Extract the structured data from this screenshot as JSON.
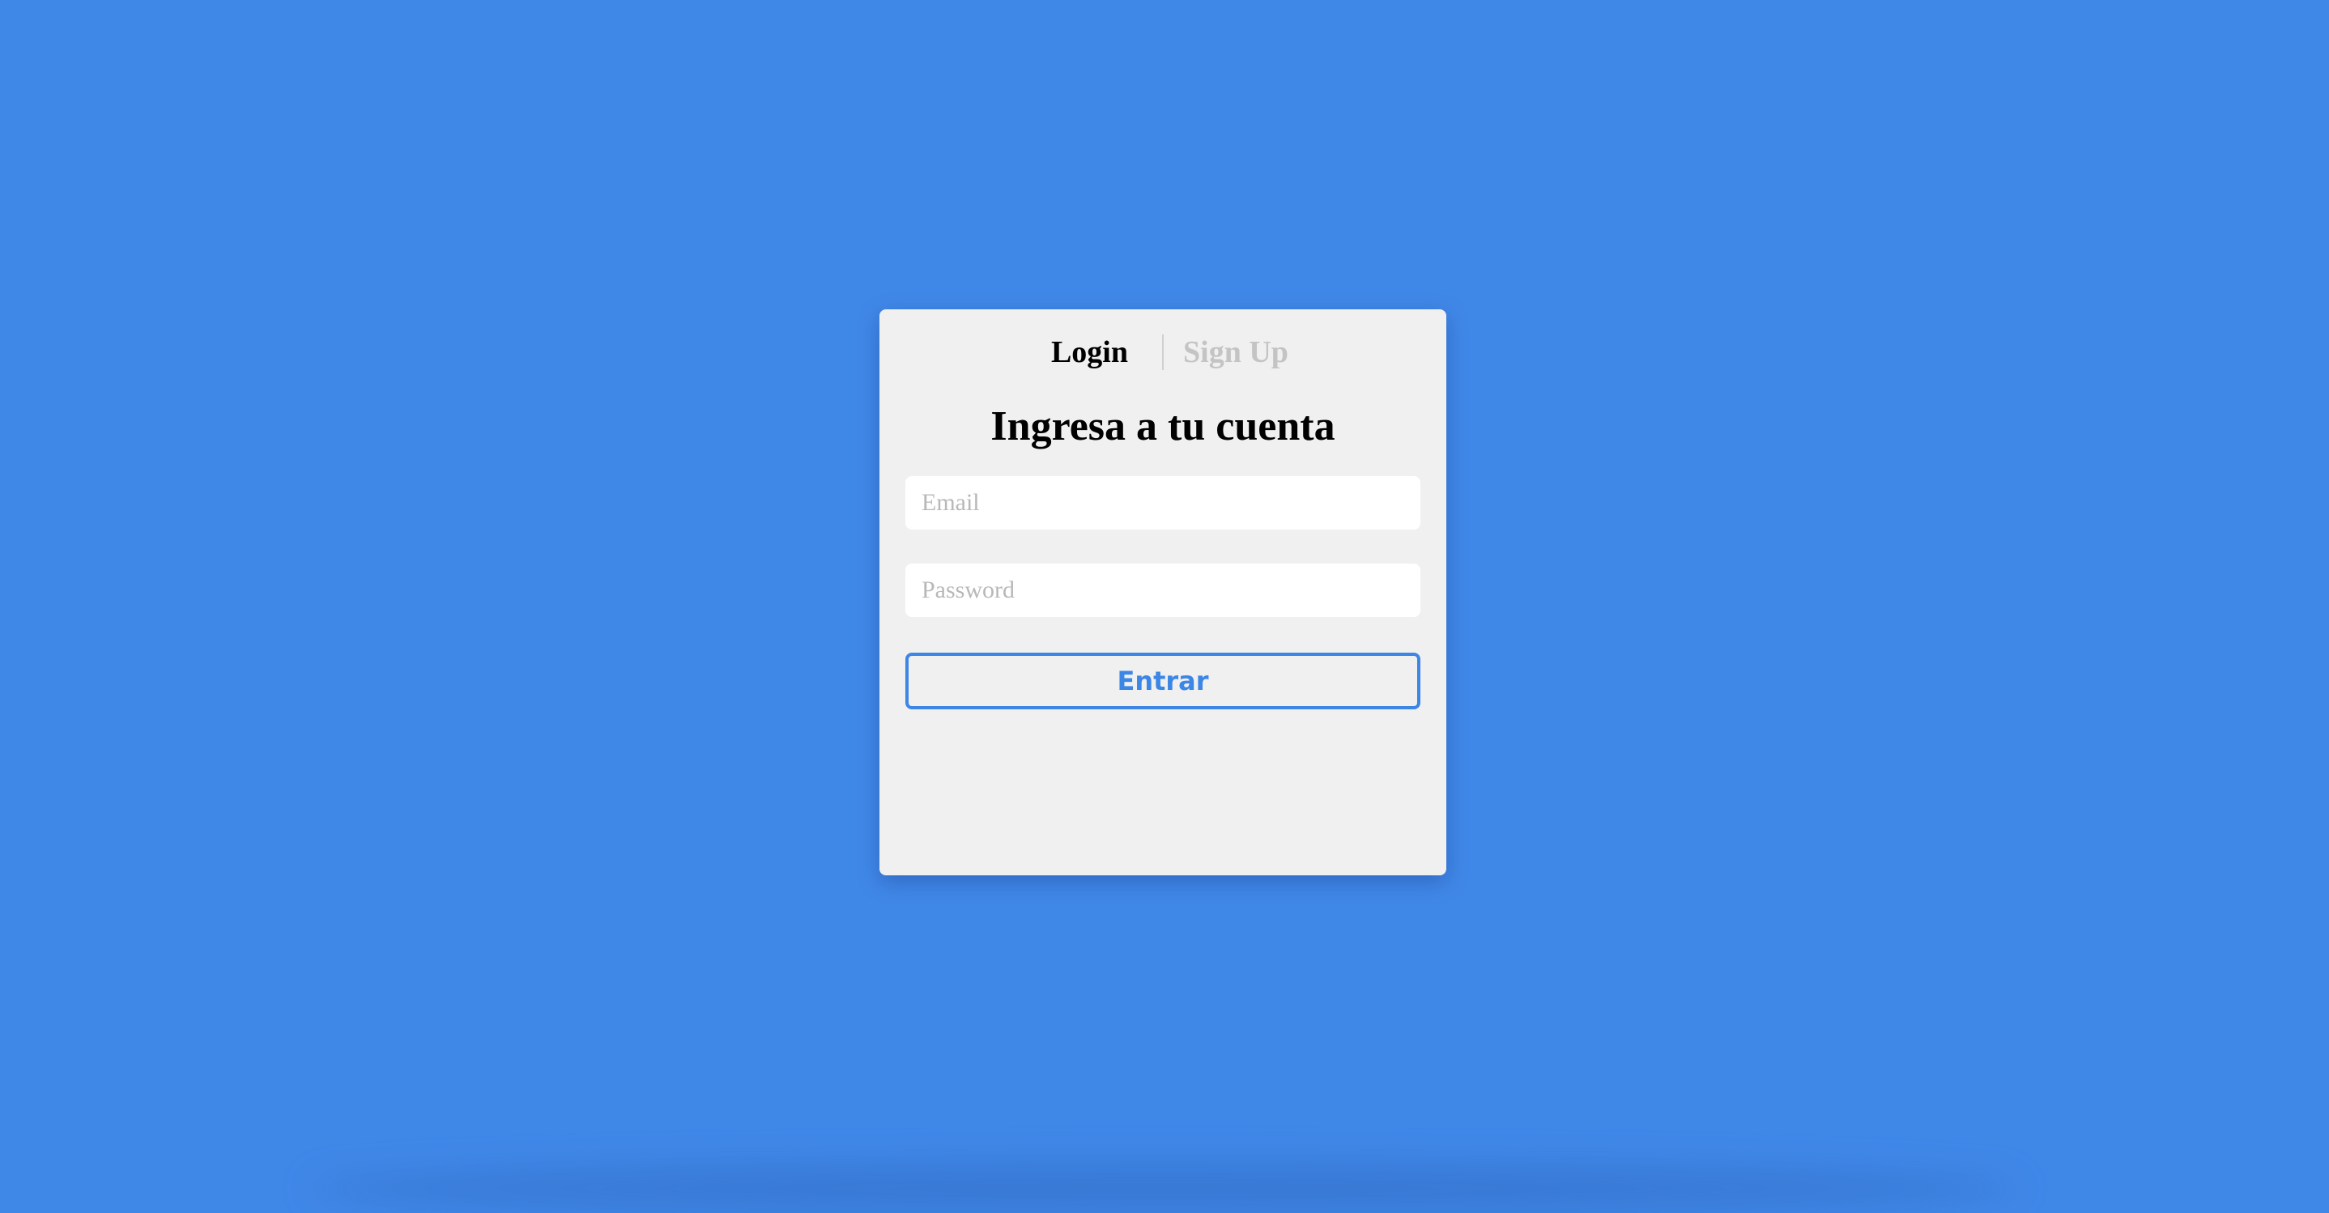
{
  "colors": {
    "background": "#4088e8",
    "card": "#f0f0f0",
    "accent": "#3c86e6",
    "tab_inactive": "#c4c4c4"
  },
  "tabs": {
    "login_label": "Login",
    "signup_label": "Sign Up",
    "active": "Login"
  },
  "login_form": {
    "title": "Ingresa a tu cuenta",
    "email_placeholder": "Email",
    "email_value": "",
    "password_placeholder": "Password",
    "password_value": "",
    "submit_label": "Entrar"
  }
}
